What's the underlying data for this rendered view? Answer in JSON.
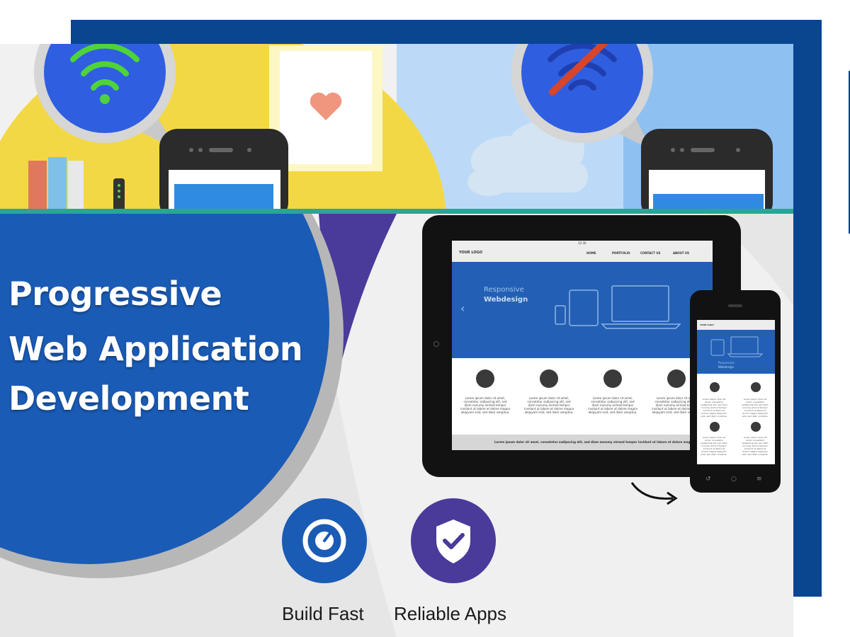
{
  "headline": {
    "line1": "Progressive",
    "line2": "Web Application",
    "line3": "Development"
  },
  "tablet": {
    "logo": "YOUR LOGO",
    "status_time": "12:30",
    "nav": [
      "HOME",
      "PORTFOLIO",
      "CONTACT US",
      "ABOUT US"
    ],
    "hero_line1": "Responsive",
    "hero_line2": "Webdesign",
    "feature_text": "Lorem ipsum dolor sit amet, consetetur sadipscing elit, sed diam nonumy eirmod tempor invidunt ut labore et dolore magna aliquyam erat, sed diam voluptua.",
    "footer_text": "Lorem ipsum dolor sit amet, consetetur sadipscing elit, sed diam nonumy eirmod tempor invidunt ut labore et dolore magna"
  },
  "phone": {
    "logo": "YOUR LOGO",
    "hero_line1": "Responsive",
    "hero_line2": "Webdesign"
  },
  "features": [
    {
      "label": "Build Fast",
      "icon": "speedometer-icon",
      "color": "#1a5bb5"
    },
    {
      "label": "Reliable Apps",
      "icon": "shield-check-icon",
      "color": "#4a3a9a"
    }
  ],
  "colors": {
    "brand_blue": "#1a5bb5",
    "frame_blue": "#0a4590",
    "teal": "#2aa596",
    "purple": "#4a3a9a",
    "yellow": "#f3d845"
  },
  "illustration_icons": [
    "wifi-icon",
    "wifi-off-icon",
    "heart-icon",
    "cloud-icon",
    "books-icon"
  ]
}
